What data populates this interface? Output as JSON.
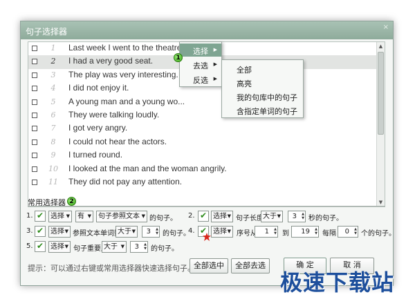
{
  "window": {
    "title": "句子选择器",
    "close_glyph": "×"
  },
  "list": {
    "rows": [
      {
        "num": "1",
        "text": "Last week I went to the theatre.",
        "selected": false
      },
      {
        "num": "2",
        "text": "I had a very good seat.",
        "selected": true
      },
      {
        "num": "3",
        "text": "The play was very interesting.",
        "selected": false
      },
      {
        "num": "4",
        "text": "I did not enjoy it.",
        "selected": false
      },
      {
        "num": "5",
        "text": "A young man and a young wo...",
        "selected": false
      },
      {
        "num": "6",
        "text": "They were talking loudly.",
        "selected": false
      },
      {
        "num": "7",
        "text": "I got very angry.",
        "selected": false
      },
      {
        "num": "8",
        "text": "I could not hear the actors.",
        "selected": false
      },
      {
        "num": "9",
        "text": "I turned round.",
        "selected": false
      },
      {
        "num": "10",
        "text": "I looked at the man and the woman angrily.",
        "selected": false
      },
      {
        "num": "11",
        "text": "They did not pay any attention.",
        "selected": false
      }
    ]
  },
  "context_menu": {
    "badge": "1",
    "items": [
      {
        "label": "选择",
        "highlight": true
      },
      {
        "label": "去选",
        "highlight": false
      },
      {
        "label": "反选",
        "highlight": false
      }
    ],
    "submenu": [
      "全部",
      "高亮",
      "我的句库中的句子",
      "含指定单词的句子"
    ]
  },
  "common": {
    "title": "常用选择器",
    "badge": "2",
    "r1": {
      "num": "1.",
      "action": "选择",
      "op": "有",
      "field": "句子参照文本",
      "suffix": "的句子。"
    },
    "r2": {
      "num": "2.",
      "action": "选择",
      "field": "句子长度",
      "op": "大于",
      "value": "3",
      "suffix": "秒的句子。"
    },
    "r3": {
      "num": "3.",
      "action": "选择",
      "field": "参照文本单词数",
      "op": "大于",
      "value": "3",
      "suffix": "的句子。"
    },
    "r4": {
      "num": "4.",
      "action": "选择",
      "field": "序号从",
      "from": "1",
      "to_label": "到",
      "to": "19",
      "every_label": "每隔",
      "every": "0",
      "suffix": "个的句子。"
    },
    "r5": {
      "num": "5.",
      "action": "选择",
      "field": "句子重要度",
      "op": "大于",
      "value": "3",
      "suffix": "的句子。"
    }
  },
  "footer": {
    "hint": "提示：可以通过右键或常用选择器快速选择句子。",
    "select_all": "全部选中",
    "deselect_all": "全部去选",
    "ok": "确 定",
    "cancel": "取 消"
  },
  "watermark": "极速下载站",
  "colors": {
    "title_bar": "#8eab9b",
    "accent": "#7fa592",
    "tick": "#2d8a1a",
    "watermark": "#1d4f9c"
  }
}
